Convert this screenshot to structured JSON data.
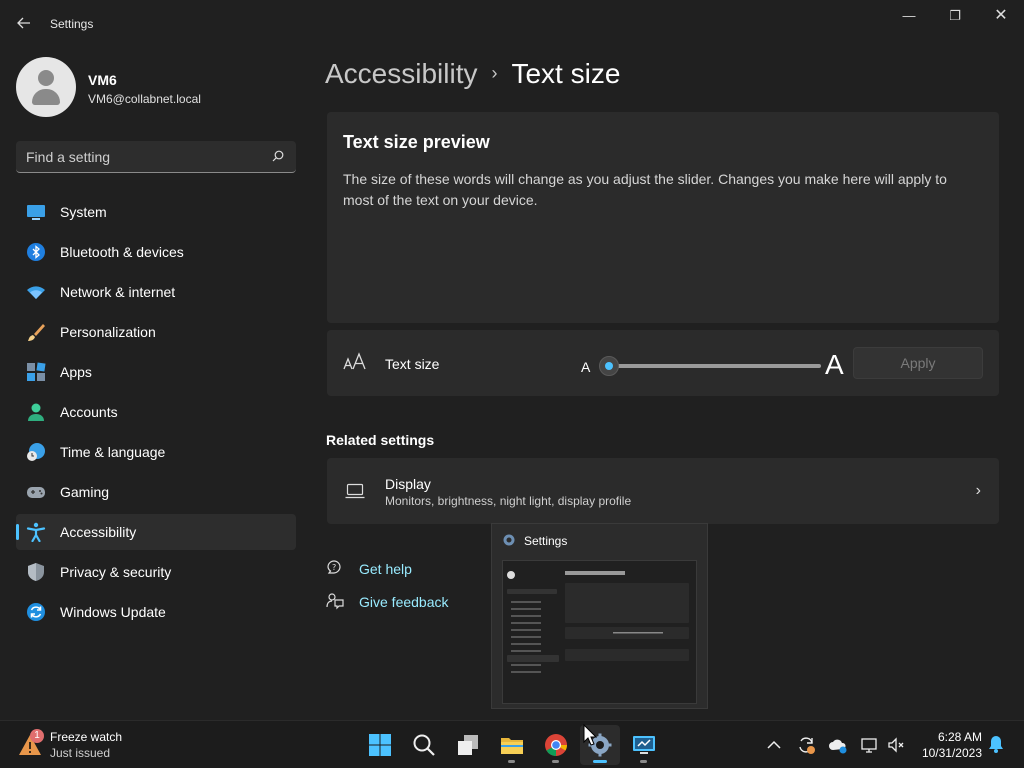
{
  "window": {
    "app_title": "Settings",
    "controls": {
      "minimize": "—",
      "maximize": "❐",
      "close": "✕"
    }
  },
  "profile": {
    "name": "VM6",
    "email": "VM6@collabnet.local"
  },
  "search": {
    "placeholder": "Find a setting",
    "value": ""
  },
  "sidebar": {
    "items": [
      {
        "label": "System",
        "icon": "system-icon",
        "active": false
      },
      {
        "label": "Bluetooth & devices",
        "icon": "bluetooth-icon",
        "active": false
      },
      {
        "label": "Network & internet",
        "icon": "wifi-icon",
        "active": false
      },
      {
        "label": "Personalization",
        "icon": "brush-icon",
        "active": false
      },
      {
        "label": "Apps",
        "icon": "apps-icon",
        "active": false
      },
      {
        "label": "Accounts",
        "icon": "accounts-icon",
        "active": false
      },
      {
        "label": "Time & language",
        "icon": "globe-clock-icon",
        "active": false
      },
      {
        "label": "Gaming",
        "icon": "gamepad-icon",
        "active": false
      },
      {
        "label": "Accessibility",
        "icon": "accessibility-icon",
        "active": true
      },
      {
        "label": "Privacy & security",
        "icon": "shield-icon",
        "active": false
      },
      {
        "label": "Windows Update",
        "icon": "update-icon",
        "active": false
      }
    ]
  },
  "breadcrumb": {
    "parent": "Accessibility",
    "separator": "›",
    "current": "Text size"
  },
  "preview": {
    "title": "Text size preview",
    "text": "The size of these words will change as you adjust the slider. Changes you make here will apply to most of the text on your device."
  },
  "text_size": {
    "label": "Text size",
    "small_a": "A",
    "large_a": "A",
    "slider_level": 0,
    "apply_label": "Apply",
    "apply_enabled": false
  },
  "related": {
    "title": "Related settings",
    "display": {
      "title": "Display",
      "subtitle": "Monitors, brightness, night light, display profile",
      "chevron": "›"
    }
  },
  "help": {
    "get_help": "Get help",
    "give_feedback": "Give feedback"
  },
  "thumbnail": {
    "title": "Settings"
  },
  "taskbar": {
    "weather": {
      "title": "Freeze watch",
      "subtitle": "Just issued",
      "badge": "1"
    },
    "clock": {
      "time": "6:28 AM",
      "date": "10/31/2023"
    },
    "apps": [
      "start-icon",
      "search-icon",
      "task-view-icon",
      "file-explorer-icon",
      "chrome-icon",
      "settings-icon",
      "remote-desktop-icon"
    ]
  },
  "colors": {
    "accent": "#4cc2ff",
    "background": "#202020",
    "card": "#2b2b2b",
    "link": "#99ebff"
  }
}
